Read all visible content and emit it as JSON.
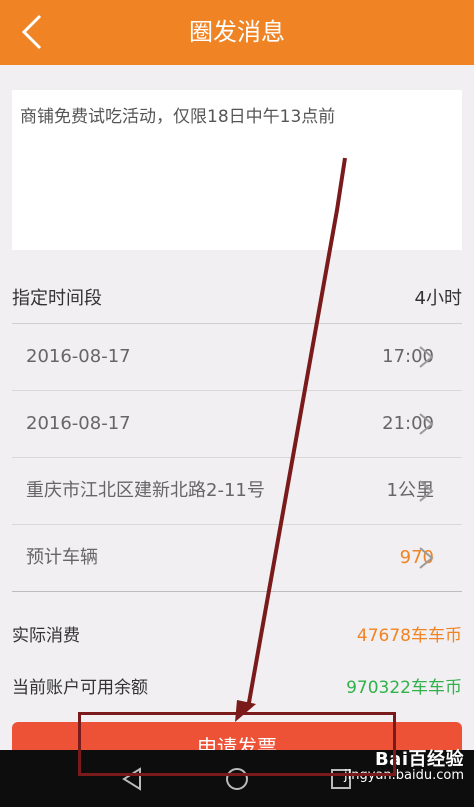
{
  "header": {
    "title": "圈发消息",
    "back_icon": "chevron-left-icon"
  },
  "message": {
    "text": "商铺免费试吃活动，仅限18日中午13点前"
  },
  "time_section": {
    "label": "指定时间段",
    "value": "4小时"
  },
  "rows": [
    {
      "left": "2016-08-17",
      "right": "17:00",
      "right_color": "default"
    },
    {
      "left": "2016-08-17",
      "right": "21:00",
      "right_color": "default"
    },
    {
      "left": "重庆市江北区建新北路2-11号",
      "right": "1公里",
      "right_color": "default"
    },
    {
      "left": "预计车辆",
      "right": "970",
      "right_color": "orange"
    }
  ],
  "summary": {
    "actual_cost_label": "实际消费",
    "actual_cost_value": "47678车车币",
    "balance_label": "当前账户可用余额",
    "balance_value": "970322车车币"
  },
  "submit": {
    "label": "申请发票"
  },
  "nav": {
    "back_icon": "nav-back-icon",
    "home_icon": "nav-home-icon",
    "recent_icon": "nav-recent-icon"
  },
  "watermark": {
    "main": "Bai百经验",
    "sub": "jingyan.baidu.com"
  },
  "colors": {
    "header": "#f08424",
    "orange_text": "#f08424",
    "green_text": "#2fb24a",
    "button": "#ee5236",
    "annotation": "#7a1a1a"
  }
}
